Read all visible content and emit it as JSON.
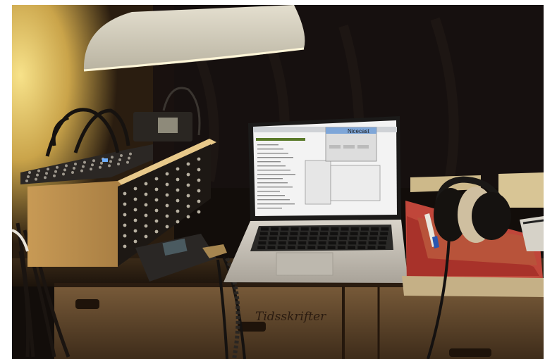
{
  "photo": {
    "scene": "podcast studio desk",
    "laptop_screen": {
      "app_window_title": "Nicecast",
      "page_header": ""
    },
    "drawer_label": "Tidsskrifter",
    "colors": {
      "wall_warm": "#f2d77a",
      "backdrop_dark": "#141010",
      "desk_wood": "#b89565",
      "lamp_shade": "#d8d3c2",
      "screen_bg": "#f3f3f3",
      "book_red": "#b33a2e",
      "laptop_silver": "#c9c6c0"
    },
    "icons": [
      "lamp-shade",
      "audio-mixer",
      "rack-patchbay",
      "field-recorder",
      "laptop",
      "headphones",
      "book-stack",
      "marker-pen"
    ]
  }
}
